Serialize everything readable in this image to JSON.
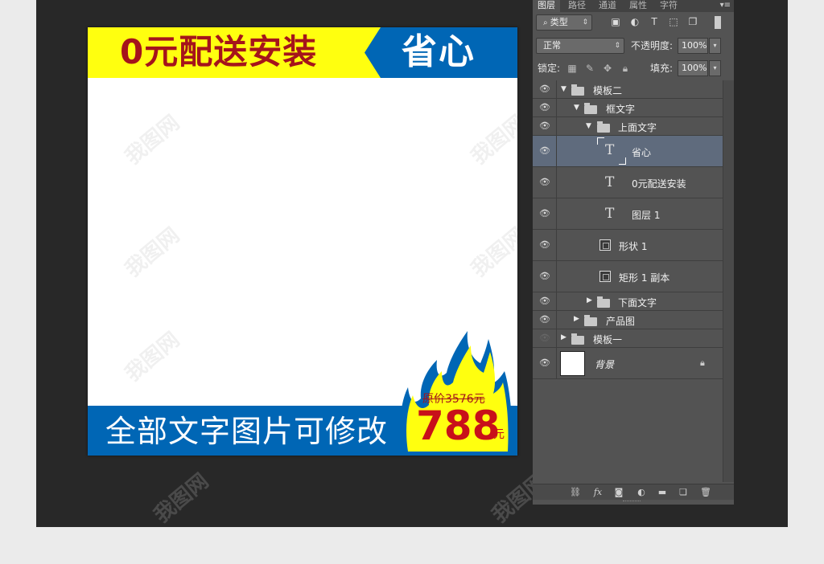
{
  "canvas": {
    "top_banner_text": "0元配送安装",
    "top_right_text": "省心",
    "bottom_banner_text": "全部文字图片可修改",
    "price": {
      "original": "原价3576元",
      "sale": "788",
      "unit": "元"
    },
    "colors": {
      "yellow": "#ffff0f",
      "blue": "#0066b5",
      "red": "#a5141b"
    }
  },
  "watermark_text": "我图网",
  "layers_panel": {
    "tabs": [
      "图层",
      "路径",
      "通道",
      "属性",
      "字符"
    ],
    "active_tab": "图层",
    "filter_kind": "类型",
    "blend_mode": "正常",
    "opacity_label": "不透明度:",
    "opacity_value": "100%",
    "lock_label": "锁定:",
    "fill_label": "填充:",
    "fill_value": "100%",
    "layers": [
      {
        "name": "模板二",
        "kind": "group",
        "expanded": true
      },
      {
        "name": "框文字",
        "kind": "group",
        "expanded": true
      },
      {
        "name": "上面文字",
        "kind": "group",
        "expanded": true
      },
      {
        "name": "省心",
        "kind": "text",
        "selected": true
      },
      {
        "name": "0元配送安装",
        "kind": "text"
      },
      {
        "name": "图层 1",
        "kind": "text"
      },
      {
        "name": "形状 1",
        "kind": "shape"
      },
      {
        "name": "矩形 1 副本",
        "kind": "shape"
      },
      {
        "name": "下面文字",
        "kind": "group",
        "expanded": false
      },
      {
        "name": "产品图",
        "kind": "group",
        "expanded": false
      },
      {
        "name": "模板一",
        "kind": "group",
        "expanded": false
      },
      {
        "name": "背景",
        "kind": "background",
        "locked": true
      }
    ],
    "footer_icons": [
      "link-icon",
      "fx-icon",
      "mask-icon",
      "adjustment-icon",
      "group-folder-icon",
      "new-layer-icon",
      "trash-icon"
    ]
  }
}
